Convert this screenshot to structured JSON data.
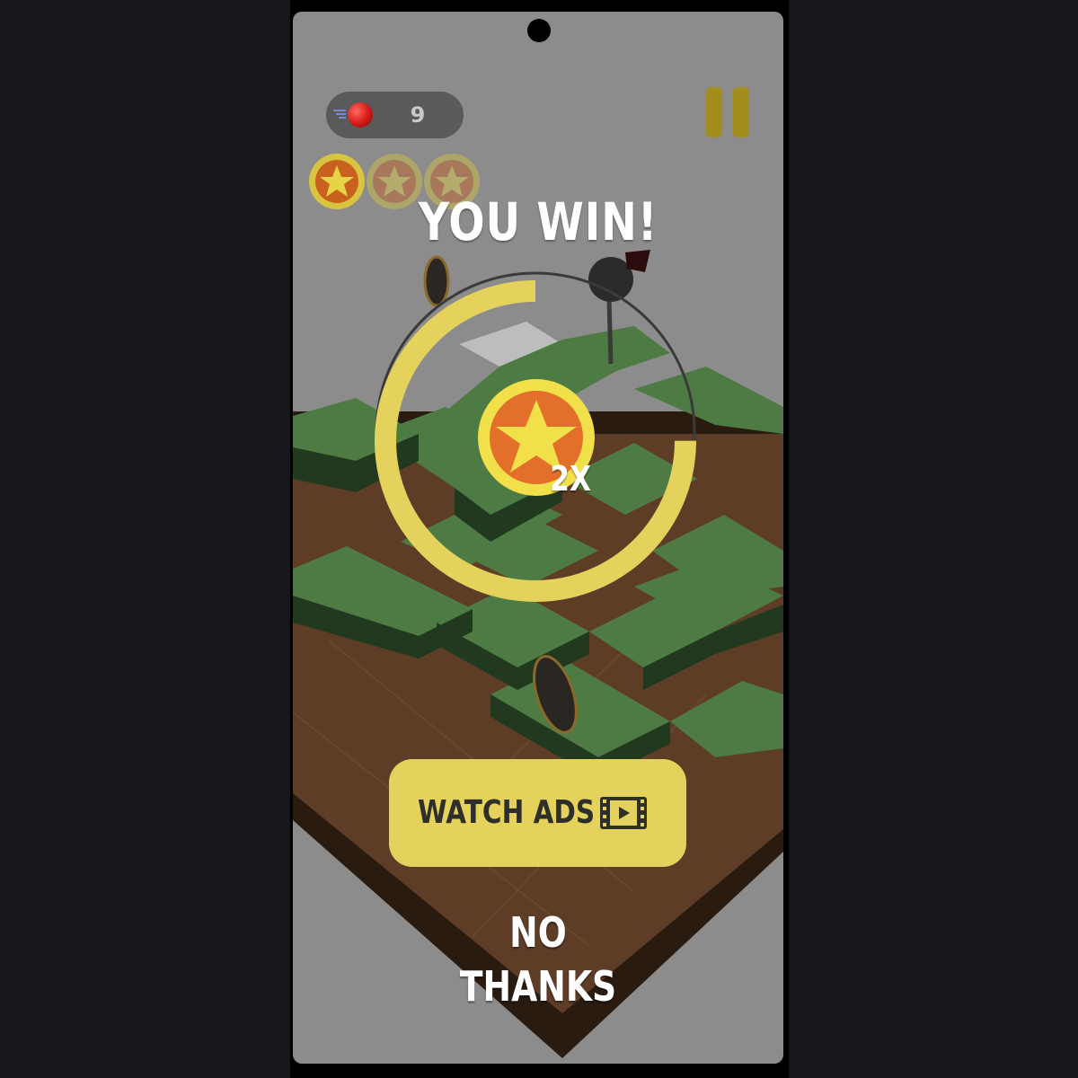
{
  "hud": {
    "ball_count": "9",
    "stars_earned": 1,
    "stars_total": 3
  },
  "win_popup": {
    "title": "YOU WIN!",
    "reward_multiplier": "2X",
    "timer_progress": 0.75,
    "watch_ads_label": "WATCH ADS",
    "no_thanks_label": "NO THANKS"
  },
  "colors": {
    "accent_yellow": "#e4d25c",
    "coin_orange": "#e2702a",
    "star_yellow": "#f1e04a",
    "maze_green": "#4d7b43",
    "maze_floor": "#5a3a25",
    "pause_color": "#a38e1d"
  },
  "icons": {
    "ball": "red-ball-icon",
    "pause": "pause-icon",
    "star": "star-coin-icon",
    "video": "video-ad-icon"
  }
}
